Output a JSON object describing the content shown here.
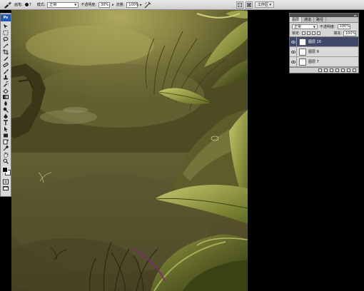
{
  "options_bar": {
    "brush_label": "画笔:",
    "brush_size": "7",
    "mode_label": "模式:",
    "mode_value": "正常",
    "opacity_label": "不透明度:",
    "opacity_value": "30%",
    "flow_label": "流量:",
    "flow_value": "100%",
    "workspace_label": "工作区 ▾"
  },
  "toolbox": {
    "logo": "Ps"
  },
  "layers_panel": {
    "tabs": [
      {
        "label": "图层"
      },
      {
        "label": "通道"
      },
      {
        "label": "路径"
      }
    ],
    "blend_mode": "正常",
    "opacity_label": "不透明度:",
    "opacity_value": "100%",
    "lock_label": "锁定:",
    "fill_label": "填充:",
    "fill_value": "100%",
    "layers": [
      {
        "name": "图层 10",
        "selected": true
      },
      {
        "name": "图层 9",
        "selected": false
      },
      {
        "name": "图层 7",
        "selected": false
      }
    ]
  },
  "colors": {
    "foreground": "#0a0a0a",
    "background": "#ffffff",
    "selected_layer": "#404a68",
    "app_bg": "#000000"
  }
}
